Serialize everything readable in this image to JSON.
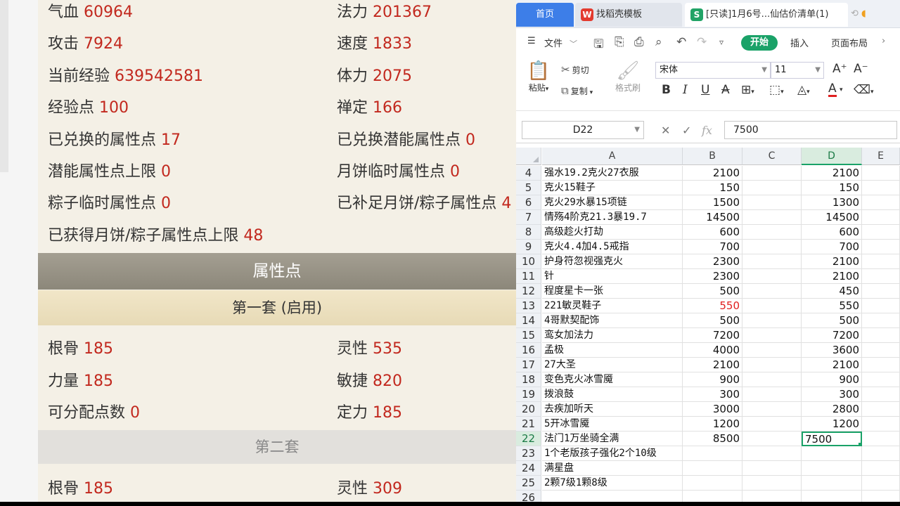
{
  "game": {
    "stats_top": [
      {
        "label": "气血",
        "value": "60964"
      },
      {
        "label": "法力",
        "value": "201367"
      },
      {
        "label": "攻击",
        "value": "7924"
      },
      {
        "label": "速度",
        "value": "1833"
      },
      {
        "label": "当前经验",
        "value": "639542581"
      },
      {
        "label": "体力",
        "value": "2075"
      },
      {
        "label": "经验点",
        "value": "100"
      },
      {
        "label": "禅定",
        "value": "166"
      },
      {
        "label": "已兑换的属性点",
        "value": "17"
      },
      {
        "label": "已兑换潜能属性点",
        "value": "0"
      },
      {
        "label": "潜能属性点上限",
        "value": "0"
      },
      {
        "label": "月饼临时属性点",
        "value": "0"
      },
      {
        "label": "粽子临时属性点",
        "value": "0"
      },
      {
        "label": "已补足月饼/粽子属性点",
        "value": "4"
      },
      {
        "label": "已获得月饼/粽子属性点上限",
        "value": "48"
      }
    ],
    "section_title": "属性点",
    "set1_title": "第一套 (启用)",
    "set1_stats": [
      {
        "label": "根骨",
        "value": "185"
      },
      {
        "label": "灵性",
        "value": "535"
      },
      {
        "label": "力量",
        "value": "185"
      },
      {
        "label": "敏捷",
        "value": "820"
      },
      {
        "label": "可分配点数",
        "value": "0"
      },
      {
        "label": "定力",
        "value": "185"
      }
    ],
    "set2_title": "第二套",
    "set2_stats": [
      {
        "label": "根骨",
        "value": "185"
      },
      {
        "label": "灵性",
        "value": "309"
      }
    ]
  },
  "wps": {
    "tabs": {
      "home": "首页",
      "template": "找稻壳模板",
      "template_icon": "W",
      "doc": "[只读]1月6号...仙估价清单(1)",
      "doc_icon": "S"
    },
    "menu": {
      "file": "文件",
      "start": "开始",
      "insert": "插入",
      "layout": "页面布局"
    },
    "ribbon": {
      "paste": "粘贴",
      "cut": "剪切",
      "copy": "复制",
      "format_painter": "格式刷",
      "font_name": "宋体",
      "font_size": "11"
    },
    "formula": {
      "cell_ref": "D22",
      "value": "7500"
    },
    "columns": [
      "A",
      "B",
      "C",
      "D",
      "E"
    ],
    "rows": [
      {
        "n": "4",
        "a": "强水19.2克火27衣服",
        "b": "2100",
        "d": "2100"
      },
      {
        "n": "5",
        "a": "克火15鞋子",
        "b": "150",
        "d": "150"
      },
      {
        "n": "6",
        "a": "克火29水暴15项链",
        "b": "1500",
        "d": "1300"
      },
      {
        "n": "7",
        "a": "情殇4阶克21.3暴19.7",
        "b": "14500",
        "d": "14500"
      },
      {
        "n": "8",
        "a": "高级趁火打劫",
        "b": "600",
        "d": "600"
      },
      {
        "n": "9",
        "a": "克火4.4加4.5戒指",
        "b": "700",
        "d": "700"
      },
      {
        "n": "10",
        "a": "护身符忽视强克火",
        "b": "2300",
        "d": "2100"
      },
      {
        "n": "11",
        "a": "针",
        "b": "2300",
        "d": "2100"
      },
      {
        "n": "12",
        "a": "程度星卡一张",
        "b": "500",
        "d": "450"
      },
      {
        "n": "13",
        "a": "221敏灵鞋子",
        "b": "550",
        "d": "550"
      },
      {
        "n": "14",
        "a": "4哥默契配饰",
        "b": "500",
        "d": "500"
      },
      {
        "n": "15",
        "a": "鸾女加法力",
        "b": "7200",
        "d": "7200"
      },
      {
        "n": "16",
        "a": "孟极",
        "b": "4000",
        "d": "3600"
      },
      {
        "n": "17",
        "a": "27大圣",
        "b": "2100",
        "d": "2100"
      },
      {
        "n": "18",
        "a": "变色克火冰雪魇",
        "b": "900",
        "d": "900"
      },
      {
        "n": "19",
        "a": "拨浪鼓",
        "b": "300",
        "d": "300"
      },
      {
        "n": "20",
        "a": "去疾加听天",
        "b": "3000",
        "d": "2800"
      },
      {
        "n": "21",
        "a": "5开冰雪魇",
        "b": "1200",
        "d": "1200"
      },
      {
        "n": "22",
        "a": "法门1万坐骑全满",
        "b": "8500",
        "d": "7500"
      },
      {
        "n": "23",
        "a": "1个老版孩子强化2个10级",
        "b": "",
        "d": ""
      },
      {
        "n": "24",
        "a": "满星盘",
        "b": "",
        "d": ""
      },
      {
        "n": "25",
        "a": "2颗7级1颗8级",
        "b": "",
        "d": ""
      },
      {
        "n": "26",
        "a": "",
        "b": "",
        "d": ""
      }
    ],
    "highlight_color": "#e02020",
    "accent_color": "#1aa268"
  }
}
